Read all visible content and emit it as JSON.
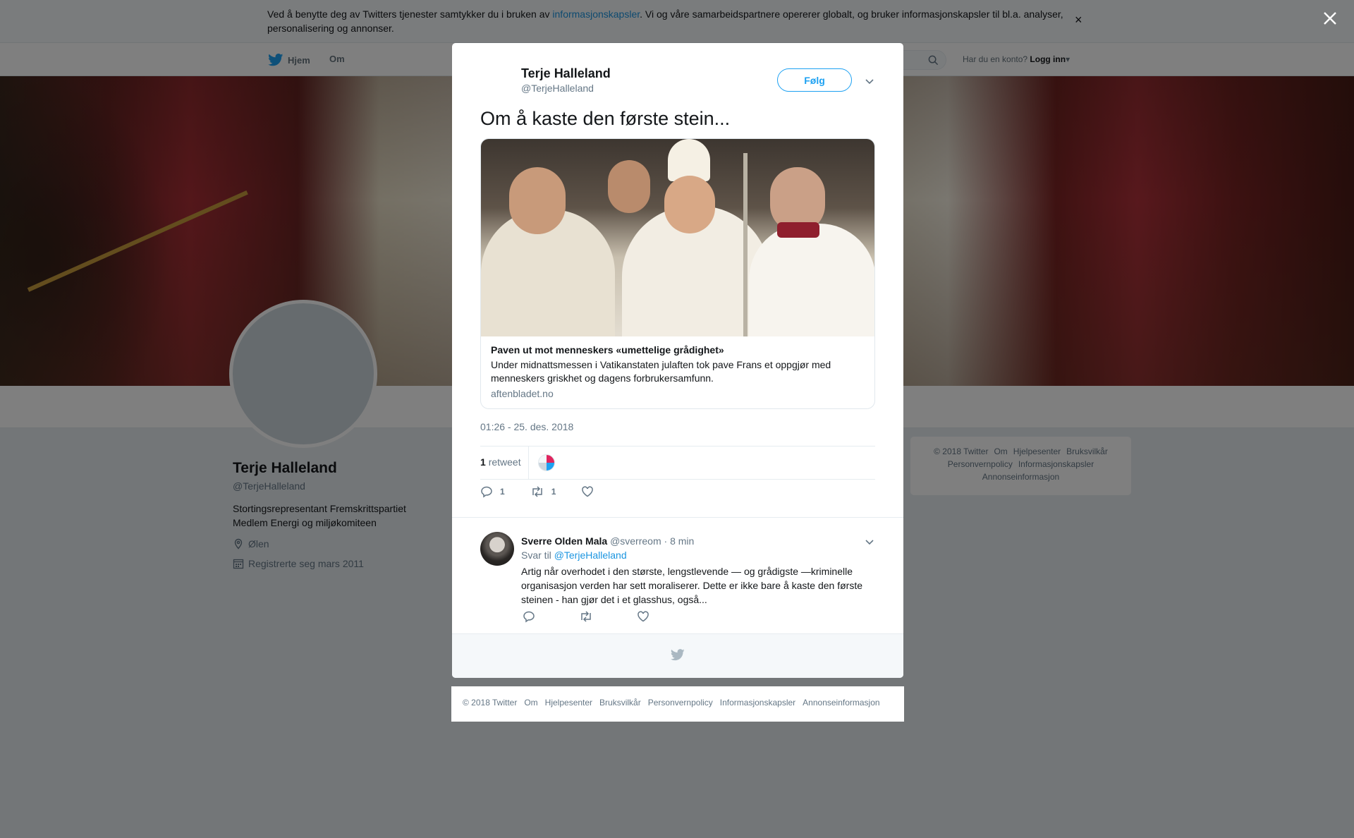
{
  "cookie": {
    "text_before": "Ved å benytte deg av Twitters tjenester samtykker du i bruken av ",
    "link": "informasjonskapsler",
    "text_after": ". Vi og våre samarbeidspartnere opererer globalt, og bruker informasjonskapsler til bl.a. analyser, personalisering og annonser.",
    "close": "×"
  },
  "nav": {
    "home": "Hjem",
    "about": "Om",
    "account_prompt": "Har du en konto?",
    "login": "Logg inn"
  },
  "profile": {
    "name": "Terje Halleland",
    "handle": "@TerjeHalleland",
    "bio_line1": "Stortingsrepresentant Fremskrittspartiet",
    "bio_line2": "Medlem Energi og miljøkomiteen",
    "location": "Ølen",
    "joined": "Registrerte seg mars 2011"
  },
  "side_footer": {
    "items": [
      "© 2018 Twitter",
      "Om",
      "Hjelpesenter",
      "Bruksvilkår",
      "Personvernpolicy",
      "Informasjonskapsler",
      "Annonseinformasjon"
    ]
  },
  "tweet": {
    "author_name": "Terje Halleland",
    "author_handle": "@TerjeHalleland",
    "follow_label": "Følg",
    "text": "Om å kaste den første stein...",
    "card_title": "Paven ut mot menneskers «umettelige grådighet»",
    "card_desc": "Under midnattsmessen i Vatikanstaten julaften tok pave Frans et oppgjør med menneskers griskhet og dagens forbrukersamfunn.",
    "card_domain": "aftenbladet.no",
    "timestamp": "01:26 - 25. des. 2018",
    "retweet_count": "1",
    "retweet_label": "retweet",
    "reply_count": "1",
    "rt_count": "1"
  },
  "reply": {
    "name": "Sverre Olden Mala",
    "handle": "@sverreom",
    "time": "· 8 min",
    "to_label": "Svar til",
    "to_handle": "@TerjeHalleland",
    "text": "Artig når overhodet i den største, lengstlevende — og grådigste —kriminelle organisasjon verden har sett moraliserer. Dette er ikke bare å kaste den  første steinen - han gjør det i et glasshus, også..."
  },
  "modal_footer": {
    "items": [
      "© 2018 Twitter",
      "Om",
      "Hjelpesenter",
      "Bruksvilkår",
      "Personvernpolicy",
      "Informasjonskapsler",
      "Annonseinformasjon"
    ]
  },
  "colors": {
    "brand": "#1da1f2",
    "link": "#1b95e0",
    "text": "#14171a",
    "muted": "#657786"
  }
}
